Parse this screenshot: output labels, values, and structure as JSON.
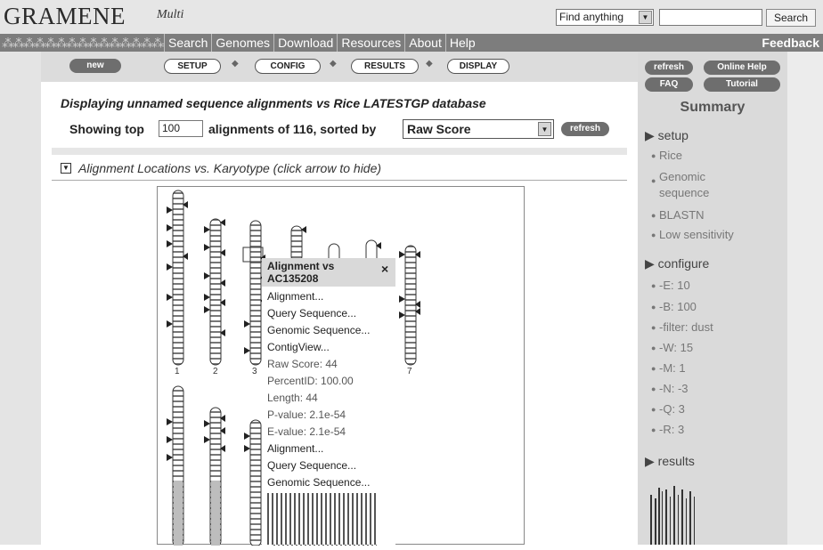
{
  "header": {
    "logo": "GRAMENE",
    "logo_sub": "Multi",
    "find_select": "Find anything",
    "search_button": "Search",
    "nav": [
      "Search",
      "Genomes",
      "Download",
      "Resources",
      "About",
      "Help"
    ],
    "feedback": "Feedback"
  },
  "steps": {
    "new": "new",
    "setup": "SETUP",
    "config": "CONFIG",
    "results": "RESULTS",
    "display": "DISPLAY",
    "sep": "◆"
  },
  "main": {
    "headline": "Displaying unnamed sequence alignments vs Rice LATESTGP database",
    "showing_label": "Showing top",
    "top_value": "100",
    "alignments_text": "alignments of 116, sorted by",
    "sort_value": "Raw Score",
    "refresh": "refresh",
    "section_title": "Alignment Locations vs. Karyotype (click arrow to hide)"
  },
  "karyotype": {
    "chromosome_labels": [
      "1",
      "2",
      "3",
      "7"
    ]
  },
  "popup": {
    "title": "Alignment vs AC135208",
    "close": "×",
    "links_top": [
      "Alignment...",
      "Query Sequence...",
      "Genomic Sequence...",
      "ContigView..."
    ],
    "stats": [
      "Raw Score: 44",
      "PercentID: 100.00",
      "Length: 44",
      "P-value: 2.1e-54",
      "E-value: 2.1e-54"
    ],
    "links_bottom": [
      "Alignment...",
      "Query Sequence...",
      "Genomic Sequence..."
    ]
  },
  "sidebar": {
    "buttons": {
      "refresh": "refresh",
      "online_help": "Online Help",
      "faq": "FAQ",
      "tutorial": "Tutorial"
    },
    "title": "Summary",
    "setup_head": "setup",
    "setup_items": [
      "Rice",
      "Genomic sequence",
      "BLASTN",
      "Low sensitivity"
    ],
    "configure_head": "configure",
    "configure_items": [
      "-E: 10",
      "-B: 100",
      "-filter: dust",
      "-W: 15",
      "-M: 1",
      "-N: -3",
      "-Q: 3",
      "-R: 3"
    ],
    "results_head": "results"
  }
}
